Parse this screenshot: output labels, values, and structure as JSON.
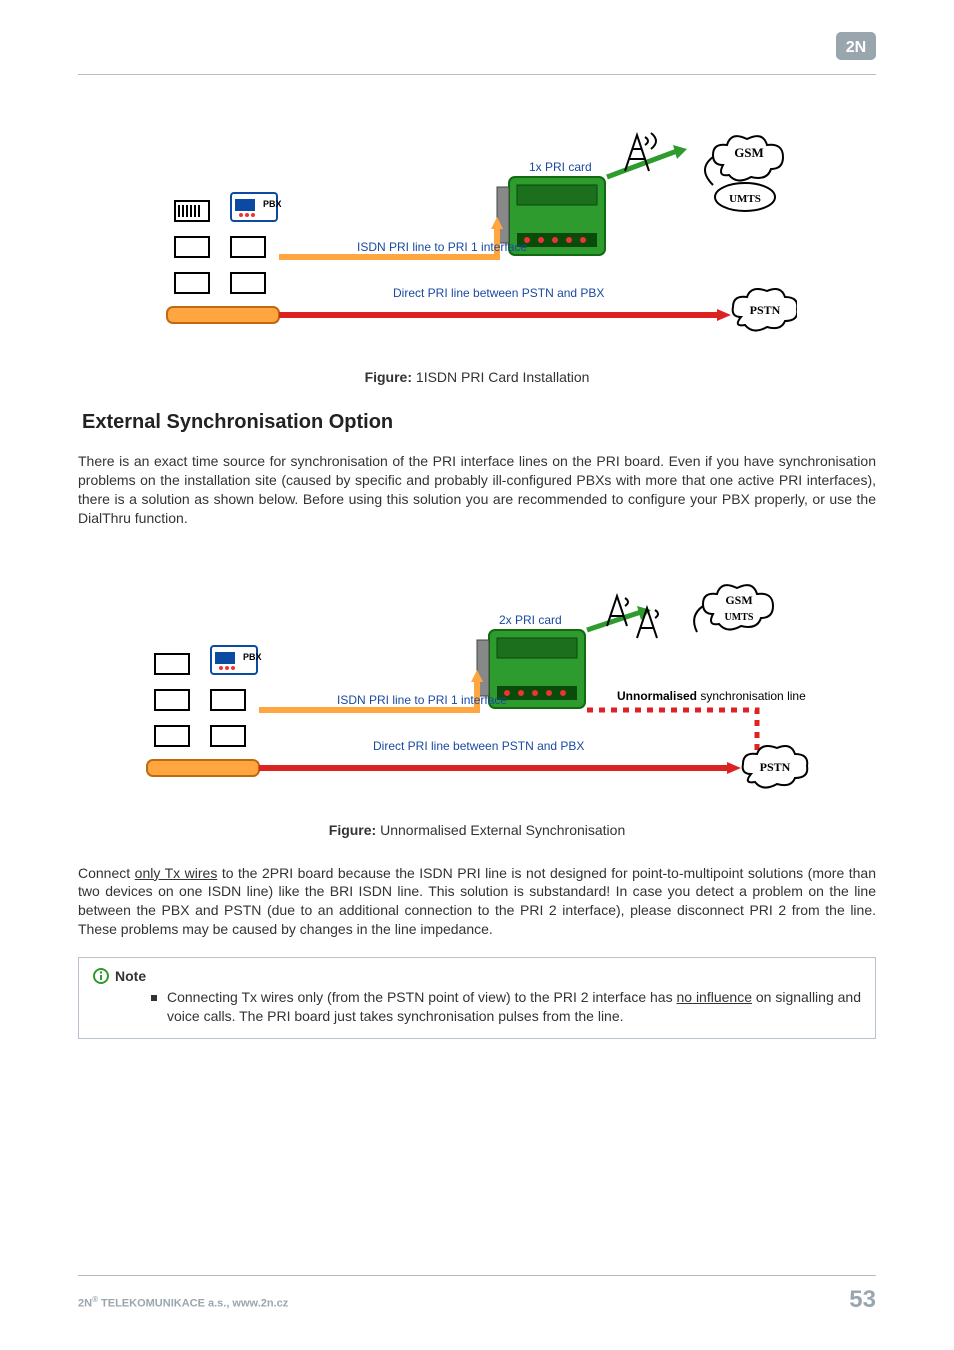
{
  "header": {
    "brand": "2N"
  },
  "figure1": {
    "caption_label": "Figure:",
    "caption_text": " 1ISDN PRI Card Installation",
    "labels": {
      "pri_card": "1x PRI card",
      "isdn_line": "ISDN PRI line to PRI 1 interface",
      "direct_line": "Direct PRI line between PSTN and PBX",
      "pbx": "PBX",
      "gsm": "GSM",
      "umts": "UMTS",
      "pstn": "PSTN"
    }
  },
  "section1": {
    "heading": "External Synchronisation Option"
  },
  "para1": "There is an exact time source for synchronisation of the PRI interface lines on the PRI board. Even if you have synchronisation problems on the installation site (caused by specific and probably ill-configured PBXs with more that one active PRI interfaces), there is a solution as shown below. Before using this solution you are recommended to configure your PBX properly, or use the DialThru function.",
  "figure2": {
    "caption_label": "Figure:",
    "caption_text": " Unnormalised External Synchronisation",
    "labels": {
      "pri_card": "2x PRI card",
      "isdn_line": "ISDN PRI line to PRI 1 interface",
      "direct_line": "Direct PRI line between PSTN and PBX",
      "sync_line_bold": "Unnormalised",
      "sync_line_rest": " synchronisation line",
      "pbx": "PBX",
      "gsm": "GSM",
      "umts": "UMTS",
      "pstn": "PSTN"
    }
  },
  "para2_pre": "Connect ",
  "para2_u": "only Tx wires",
  "para2_post": " to the 2PRI board because the ISDN PRI line is not designed for point-to-multipoint solutions (more than two devices on one ISDN line) like the BRI ISDN line. This solution is substandard! In case you detect a problem on the line between the PBX and PSTN (due to an additional connection to the PRI 2 interface), please disconnect PRI 2 from the line. These problems may be caused by changes in the line impedance.",
  "note": {
    "title": "Note",
    "item_pre": "Connecting Tx wires only (from the PSTN point of view) to the PRI 2 interface has ",
    "item_u": "no influence",
    "item_post": " on signalling and voice calls. The PRI board just takes synchronisation pulses from the line."
  },
  "footer": {
    "company_pre": "2N",
    "company_sup": "®",
    "company_post": " TELEKOMUNIKACE a.s., www.2n.cz",
    "page": "53"
  }
}
